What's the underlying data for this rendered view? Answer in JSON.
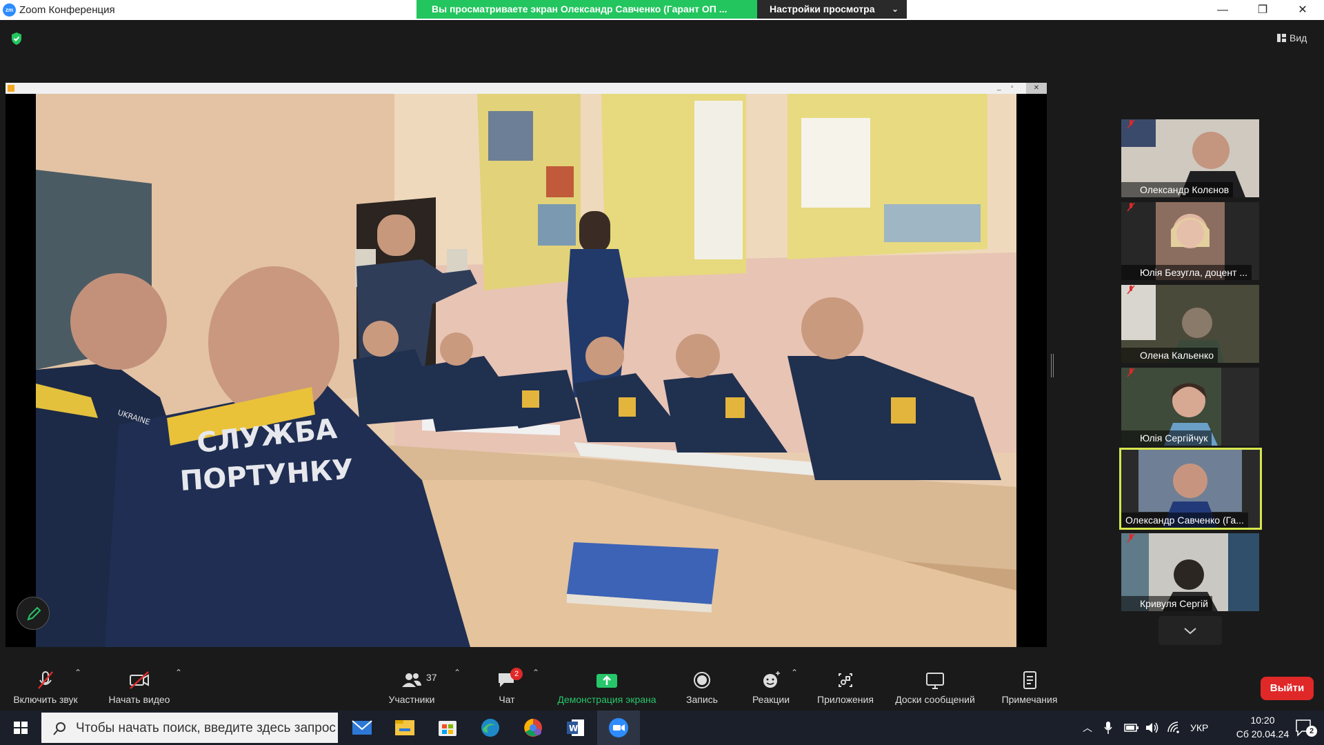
{
  "window": {
    "title": "Zoom Конференция",
    "logo_text": "zm",
    "viewing_banner": "Вы просматриваете экран Олександр Савченко (Гарант ОП ...",
    "view_options": "Настройки просмотра",
    "view_button": "Вид"
  },
  "participants": [
    {
      "name": "Олександр Колєнов",
      "muted": true
    },
    {
      "name": "Юлія Безугла, доцент ...",
      "muted": true
    },
    {
      "name": "Олена Кальенко",
      "muted": true
    },
    {
      "name": "Юлія Сергійчук",
      "muted": true
    },
    {
      "name": "Олександр Савченко (Га...",
      "muted": false,
      "active_speaker": true
    },
    {
      "name": "Кривуля Сергій",
      "muted": true
    }
  ],
  "toolbar": {
    "audio": "Включить звук",
    "video": "Начать видео",
    "participants": "Участники",
    "participants_count": "37",
    "chat": "Чат",
    "chat_badge": "2",
    "share": "Демонстрация экрана",
    "record": "Запись",
    "reactions": "Реакции",
    "apps": "Приложения",
    "whiteboards": "Доски сообщений",
    "notes": "Примечания",
    "leave": "Выйти"
  },
  "taskbar": {
    "search_placeholder": "Чтобы начать поиск, введите здесь запрос",
    "language": "УКР",
    "time": "10:20",
    "date": "Сб 20.04.24",
    "notifications": "2"
  },
  "shared_content": {
    "uniform_text_line1": "СЛУЖБА",
    "uniform_text_line2": "ПОРТУНКУ",
    "shoulder_patch": "UKRAINE"
  },
  "colors": {
    "accent_green": "#23c55e",
    "active_border": "#d6e74d",
    "leave_red": "#e02828",
    "zoom_blue": "#2d8cff"
  }
}
